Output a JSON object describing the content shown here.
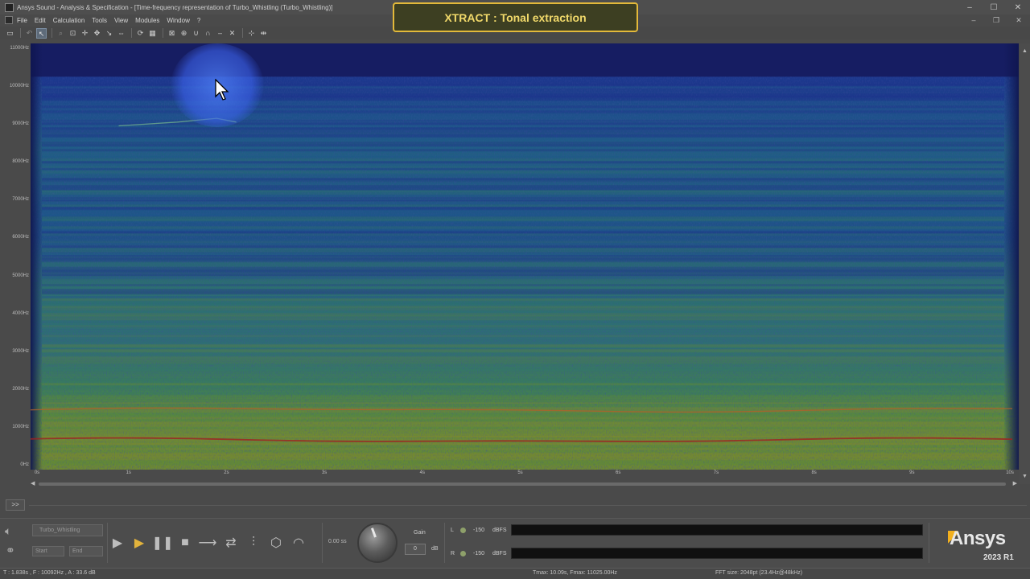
{
  "window": {
    "title": "Ansys Sound - Analysis & Specification - [Time-frequency representation of Turbo_Whistling (Turbo_Whistling)]",
    "controls": [
      "–",
      "☐",
      "✕"
    ]
  },
  "menu": {
    "items": [
      "File",
      "Edit",
      "Calculation",
      "Tools",
      "View",
      "Modules",
      "Window",
      "?"
    ],
    "mdi_controls": [
      "–",
      "❐",
      "✕"
    ]
  },
  "callout": {
    "text": "XTRACT : Tonal extraction"
  },
  "chart_data": {
    "type": "heatmap",
    "title": "",
    "xlabel": "",
    "ylabel": "",
    "x_ticks": [
      "0s",
      "1s",
      "2s",
      "3s",
      "4s",
      "5s",
      "6s",
      "7s",
      "8s",
      "9s",
      "10s"
    ],
    "y_ticks": [
      "0Hz",
      "1000Hz",
      "2000Hz",
      "3000Hz",
      "4000Hz",
      "5000Hz",
      "6000Hz",
      "7000Hz",
      "8000Hz",
      "9000Hz",
      "10000Hz",
      "11000Hz"
    ],
    "xlim": [
      0,
      10.09
    ],
    "ylim": [
      0,
      11025
    ],
    "colormap": [
      "#0d1450",
      "#1a2c8a",
      "#1d5a8c",
      "#2d7a6a",
      "#5a8a3a",
      "#8a8a2a",
      "#b0602a",
      "#a02020"
    ],
    "tonal_lines_hz": [
      1450,
      650
    ],
    "whistle_curve": {
      "x_s": [
        0.9,
        1.5,
        1.9,
        2.1
      ],
      "y_hz": [
        8950,
        9050,
        9150,
        9050
      ]
    },
    "upper_bound_hz": 10250
  },
  "bottom": {
    "expander": ">>",
    "track_name": "Turbo_Whistling",
    "start_placeholder": "Start",
    "end_placeholder": "End",
    "time_readout": "0.00 ss",
    "gain_label": "Gain",
    "gain_value": "0",
    "gain_unit": "dB",
    "meters": [
      {
        "channel": "L",
        "value": "-150",
        "unit": "dBFS"
      },
      {
        "channel": "R",
        "value": "-150",
        "unit": "dBFS"
      }
    ],
    "brand": "Ansys",
    "version": "2023 R1"
  },
  "status": {
    "cursor": "T : 1.838s , F : 10092Hz , A : 33.6 dB",
    "range": "Tmax: 10.09s, Fmax: 11025.00Hz",
    "fft": "FFT size: 2048pt (23.4Hz@48kHz)"
  },
  "colors": {
    "accent": "#e3b93a",
    "play_selected": "#e2b33c",
    "brand_mark": "#f2b01e"
  }
}
